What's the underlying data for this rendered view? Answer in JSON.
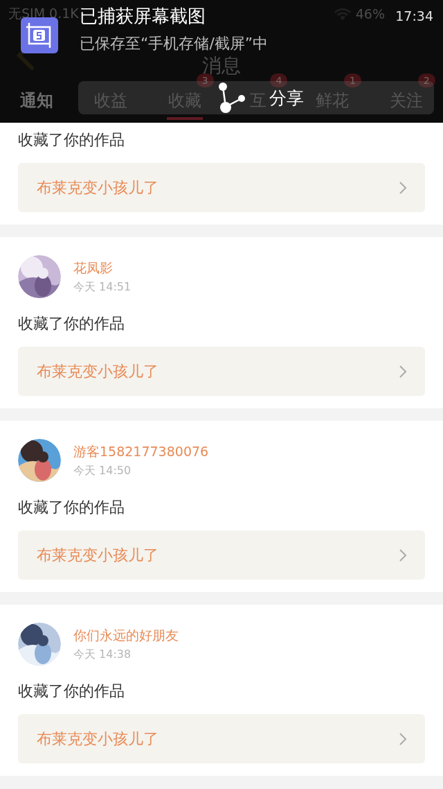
{
  "status_bar": {
    "carrier": "无SIM 0.1K",
    "battery": "46%"
  },
  "header": {
    "title": "消息"
  },
  "tabs": [
    {
      "label": "通知",
      "selected": false
    },
    {
      "label": "收益",
      "selected": false
    },
    {
      "label": "收藏",
      "selected": true,
      "badge": "3"
    },
    {
      "label": "互",
      "selected": false,
      "badge": "4"
    },
    {
      "label": "鲜花",
      "selected": false,
      "badge": "1"
    },
    {
      "label": "关注",
      "selected": false,
      "badge": "2"
    }
  ],
  "notification": {
    "title": "已捕获屏幕截图",
    "text": "已保存至“手机存储/截屏”中",
    "time": "17:34",
    "action": "分享"
  },
  "feed": [
    {
      "kind": "partial",
      "action": "收藏了你的作品",
      "work": "布莱克变小孩儿了"
    },
    {
      "kind": "full",
      "user": "花凤影",
      "time": "今天 14:51",
      "action": "收藏了你的作品",
      "work": "布莱克变小孩儿了"
    },
    {
      "kind": "full",
      "user": "游客1582177380076",
      "time": "今天 14:50",
      "action": "收藏了你的作品",
      "work": "布莱克变小孩儿了"
    },
    {
      "kind": "full",
      "user": "你们永远的好朋友",
      "time": "今天 14:38",
      "action": "收藏了你的作品",
      "work": "布莱克变小孩儿了"
    }
  ]
}
